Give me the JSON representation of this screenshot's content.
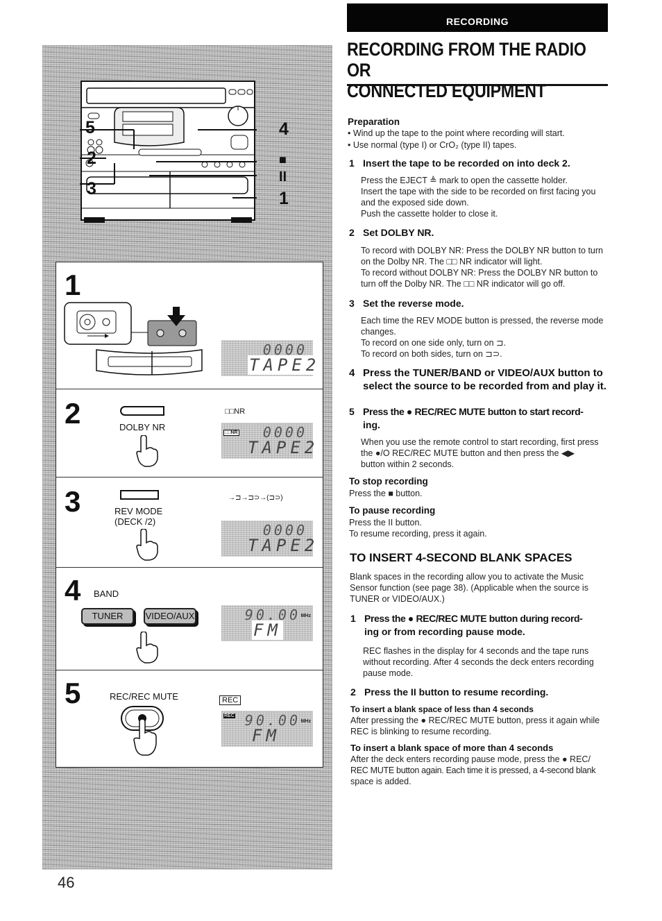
{
  "header": {
    "section_label": "RECORDING",
    "title_line1": "RECORDING FROM THE RADIO OR",
    "title_line2": "CONNECTED EQUIPMENT"
  },
  "illustration": {
    "callouts": [
      "5",
      "2",
      "3",
      "4",
      "■",
      "II",
      "1"
    ],
    "steps": [
      {
        "number": "1",
        "display_top": "0000",
        "display_main": "TAPE2"
      },
      {
        "number": "2",
        "button_label": "DOLBY NR",
        "indicator_label": "□□NR",
        "display_top": "0000",
        "display_main": "TAPE2"
      },
      {
        "number": "3",
        "button_label_line1": "REV MODE",
        "button_label_line2": "(DECK /2)",
        "rev_sequence": "→⊐→⊐⊃→(⊐⊃)",
        "display_top": "0000",
        "display_main": "TAPE2"
      },
      {
        "number": "4",
        "band_label": "BAND",
        "tuner_label": "TUNER",
        "video_aux_label": "VIDEO/AUX",
        "display_top": "90.00",
        "display_unit": "MHz",
        "display_main": "FM"
      },
      {
        "number": "5",
        "button_label": "REC/REC MUTE",
        "indicator_label": "REC",
        "display_top": "90.00",
        "display_unit": "MHz",
        "display_main": "FM"
      }
    ]
  },
  "content": {
    "preparation": {
      "heading": "Preparation",
      "bullets": [
        "• Wind up the tape to the point where recording will start.",
        "• Use normal (type I) or CrO₂ (type II) tapes."
      ]
    },
    "steps": [
      {
        "number": "1",
        "title": "Insert the tape to be recorded on into deck 2.",
        "body": [
          "Press the EJECT ≜ mark to open the cassette holder.",
          "Insert the tape with the side to be recorded on first facing you",
          "and the exposed side down.",
          "Push the cassette holder to close it."
        ]
      },
      {
        "number": "2",
        "title": "Set DOLBY NR.",
        "body": [
          "To record with DOLBY NR: Press the DOLBY NR button to turn",
          "on the Dolby NR. The □□ NR indicator will light.",
          "To record without DOLBY NR: Press the DOLBY NR button to",
          "turn off the Dolby NR. The □□ NR indicator will go off."
        ]
      },
      {
        "number": "3",
        "title": "Set the reverse mode.",
        "body": [
          "Each time the REV MODE button is pressed, the reverse mode",
          "changes.",
          "To record on one side only, turn on ⊐.",
          "To record on both sides, turn on ⊐⊃."
        ]
      },
      {
        "number": "4",
        "title_line1": "Press the TUNER/BAND or VIDEO/AUX button to",
        "title_line2": "select the source to be recorded from and play it."
      },
      {
        "number": "5",
        "title_line1": "Press the ● REC/REC MUTE button to start record-",
        "title_line2": "ing.",
        "body": [
          "When you use the remote control to start recording, first press",
          "the ●/O REC/REC MUTE button and then press the ◀▶",
          "button within 2 seconds."
        ]
      }
    ],
    "stop": {
      "heading": "To stop recording",
      "body": "Press the ■ button."
    },
    "pause": {
      "heading": "To pause recording",
      "body_line1": "Press the II button.",
      "body_line2": "To resume recording, press it again."
    },
    "blank_section": {
      "heading": "TO INSERT 4-SECOND BLANK SPACES",
      "intro": [
        "Blank spaces in the recording allow you to activate the Music",
        "Sensor function (see page 38). (Applicable when the source is",
        "TUNER or VIDEO/AUX.)"
      ],
      "step1_number": "1",
      "step1_title_line1": "Press the ● REC/REC MUTE button during record-",
      "step1_title_line2": "ing or from recording pause mode.",
      "step1_body": [
        "REC flashes in the display for 4 seconds and the tape runs",
        "without recording. After 4 seconds the deck enters recording",
        "pause mode."
      ],
      "step2_number": "2",
      "step2_title": "Press the II button to resume recording.",
      "less_heading": "To insert a blank space of less than 4 seconds",
      "less_body": [
        "After pressing the ● REC/REC MUTE button, press it again while",
        "REC is blinking to resume recording."
      ],
      "more_heading": "To insert a blank space of more than 4 seconds",
      "more_body": [
        "After the deck enters recording pause mode, press the ● REC/",
        "REC MUTE button again. Each time it is pressed, a 4-second blank",
        "space is added."
      ]
    }
  },
  "footer": {
    "page_number": "46"
  }
}
